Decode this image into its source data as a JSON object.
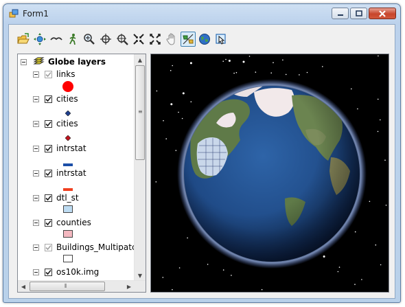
{
  "window": {
    "title": "Form1"
  },
  "caption_buttons": [
    "minimize",
    "maximize",
    "close"
  ],
  "toolbar": {
    "tools": [
      {
        "name": "open-doc-icon",
        "checked": false
      },
      {
        "name": "navigate-icon",
        "checked": false
      },
      {
        "name": "fly-icon",
        "checked": false
      },
      {
        "name": "walk-icon",
        "checked": false
      },
      {
        "name": "zoom-in-out-icon",
        "checked": false
      },
      {
        "name": "target-center-icon",
        "checked": false
      },
      {
        "name": "zoom-to-target-icon",
        "checked": false
      },
      {
        "name": "fixed-zoom-in-icon",
        "checked": false
      },
      {
        "name": "fixed-zoom-out-icon",
        "checked": false
      },
      {
        "name": "pan-icon",
        "checked": false
      },
      {
        "name": "select-features-icon",
        "checked": true
      },
      {
        "name": "full-extent-globe-icon",
        "checked": false
      },
      {
        "name": "identify-icon",
        "checked": false
      }
    ]
  },
  "toc": {
    "root": {
      "label": "Globe layers"
    },
    "layers": [
      {
        "label": "links",
        "checked": true,
        "disabled": true,
        "symbol": "circle",
        "color": "#ff0000"
      },
      {
        "label": "cities",
        "checked": true,
        "disabled": false,
        "symbol": "diamond",
        "color": "#1f3f8f"
      },
      {
        "label": "cities",
        "checked": true,
        "disabled": false,
        "symbol": "diamond",
        "color": "#c0141e"
      },
      {
        "label": "intrstat",
        "checked": true,
        "disabled": false,
        "symbol": "line",
        "color": "#1c4fa8"
      },
      {
        "label": "intrstat",
        "checked": true,
        "disabled": false,
        "symbol": "line",
        "color": "#f04020"
      },
      {
        "label": "dtl_st",
        "checked": true,
        "disabled": false,
        "symbol": "fill",
        "color": "#bedcf2"
      },
      {
        "label": "counties",
        "checked": true,
        "disabled": false,
        "symbol": "fill",
        "color": "#f4b8c0"
      },
      {
        "label": "Buildings_Multipatc",
        "checked": true,
        "disabled": true,
        "symbol": "fill",
        "color": "#ffffff"
      },
      {
        "label": "os10k.img",
        "checked": true,
        "disabled": false,
        "symbol": "none",
        "color": ""
      }
    ]
  },
  "colors": {
    "globe_background": "#000000",
    "ocean": "#1f4a86",
    "land": "#5f7a48",
    "ice": "#f2e9ea"
  }
}
